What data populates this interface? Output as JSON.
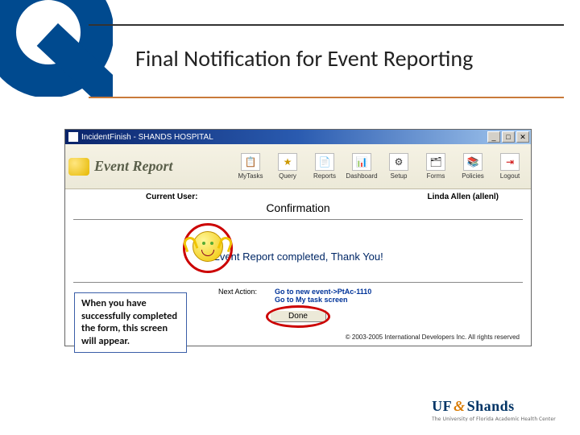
{
  "slide": {
    "title": "Final Notification for Event Reporting"
  },
  "window": {
    "title": "IncidentFinish - SHANDS HOSPITAL"
  },
  "toolbar": {
    "app_title": "Event Report",
    "buttons": {
      "mytasks": "MyTasks",
      "query": "Query",
      "reports": "Reports",
      "dashboard": "Dashboard",
      "setup": "Setup",
      "forms": "Forms",
      "policies": "Policies",
      "logout": "Logout"
    }
  },
  "content": {
    "current_user_label": "Current User:",
    "current_user_value": "Linda Allen (allenl)",
    "confirmation_heading": "Confirmation",
    "thank_you": "Event Report completed, Thank You!",
    "next_action_label": "Next Action:",
    "next_action_link1": "Go to new event->PtAc-1110",
    "next_action_link2": "Go to My task screen",
    "done_label": "Done",
    "copyright": "© 2003-2005 International Developers Inc. All rights reserved"
  },
  "callout": {
    "text": "When you have successfully completed the form, this screen will appear."
  },
  "footer": {
    "brand_uf": "UF",
    "brand_amp": "&",
    "brand_shands": "Shands",
    "tagline": "The University of Florida Academic Health Center"
  }
}
